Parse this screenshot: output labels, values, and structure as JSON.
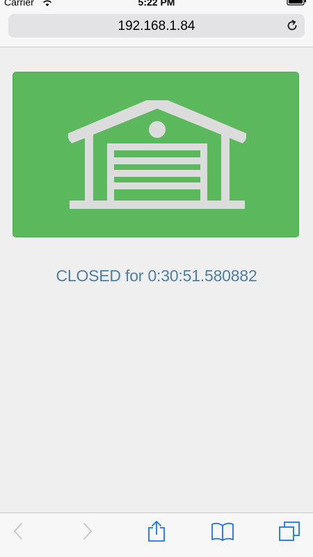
{
  "status_bar": {
    "carrier": "Carrier",
    "time": "5:22 PM",
    "icons": [
      "wifi-icon",
      "battery-icon"
    ]
  },
  "browser": {
    "url": "192.168.1.84",
    "reload_icon": "reload-icon"
  },
  "garage": {
    "icon": "garage-icon",
    "button_color": "#5cb85c",
    "status_text": "CLOSED for 0:30:51.580882",
    "status_color": "#4f7ea4"
  },
  "toolbar": {
    "items": [
      "back-icon",
      "forward-icon",
      "share-icon",
      "bookmarks-icon",
      "tabs-icon"
    ],
    "accent": "#1a73e8"
  }
}
